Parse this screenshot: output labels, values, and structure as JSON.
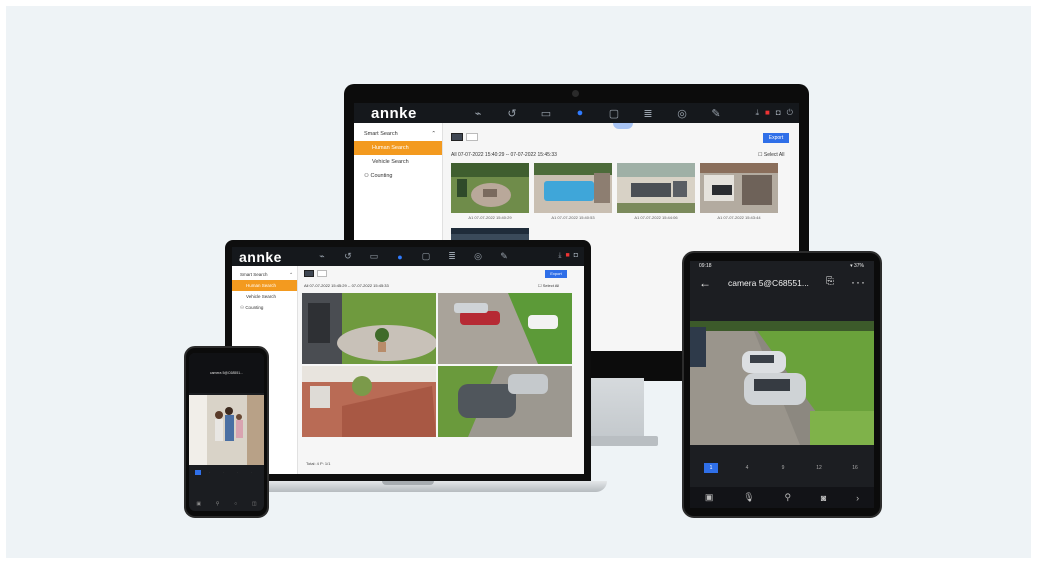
{
  "colors": {
    "accent_blue": "#2f6fe8",
    "active_orange": "#f39a1f",
    "topbar_dark": "#15181c"
  },
  "desktop": {
    "brand": "annke",
    "nav_icons": [
      "live-view-icon",
      "playback-icon",
      "files-icon",
      "smart-search-icon",
      "display-icon",
      "storage-icon",
      "settings-icon",
      "maintenance-icon"
    ],
    "status_icons": [
      "download-icon",
      "alert-icon",
      "lock-icon",
      "power-icon"
    ],
    "sidebar": {
      "items": [
        "Smart Search",
        "Human Search",
        "Vehicle Search",
        "Counting"
      ]
    },
    "export_label": "Export",
    "range": "All 07-07-2022 15:40:29 -- 07-07-2022 15:45:33",
    "select_all": "Select All",
    "thumb_captions": [
      "A1 07-07-2022 15:40:29",
      "A1 07-07-2022 15:40:53",
      "A1 07-07-2022 15:44:06",
      "A1 07-07-2022 15:43:44"
    ]
  },
  "laptop": {
    "brand": "annke",
    "sidebar": {
      "items": [
        "Smart Search",
        "Human Search",
        "Vehicle Search",
        "Counting"
      ]
    },
    "export_label": "Export",
    "range": "All 07-07-2022 15:45:29 -- 07-07-2022 15:45:33",
    "select_all": "Select All",
    "total": "Total: 4  P: 1/1"
  },
  "phone": {
    "title": "camera 5@C68551..."
  },
  "tablet": {
    "time": "09:18",
    "battery": "▾ 37%",
    "title": "camera 5@C68551...",
    "layouts": [
      "1",
      "4",
      "9",
      "12",
      "16"
    ]
  }
}
